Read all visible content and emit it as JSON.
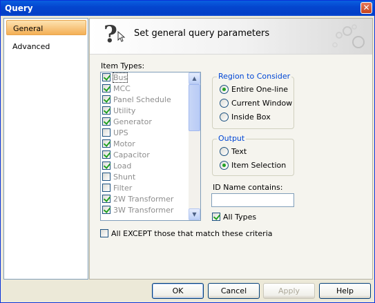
{
  "window": {
    "title": "Query",
    "close_glyph": "✕"
  },
  "nav": {
    "items": [
      {
        "label": "General",
        "active": true
      },
      {
        "label": "Advanced",
        "active": false
      }
    ]
  },
  "banner": {
    "title": "Set general query parameters",
    "icon": "help-question-icon"
  },
  "item_types": {
    "label": "Item Types:",
    "items": [
      {
        "label": "Bus",
        "checked": true
      },
      {
        "label": "MCC",
        "checked": true
      },
      {
        "label": "Panel Schedule",
        "checked": true
      },
      {
        "label": "Utility",
        "checked": true
      },
      {
        "label": "Generator",
        "checked": true
      },
      {
        "label": "UPS",
        "checked": false
      },
      {
        "label": "Motor",
        "checked": true
      },
      {
        "label": "Capacitor",
        "checked": true
      },
      {
        "label": "Load",
        "checked": true
      },
      {
        "label": "Shunt",
        "checked": false
      },
      {
        "label": "Filter",
        "checked": false
      },
      {
        "label": "2W Transformer",
        "checked": true
      },
      {
        "label": "3W Transformer",
        "checked": true
      }
    ],
    "scroll_up": "▲",
    "scroll_down": "▼"
  },
  "region": {
    "title": "Region to Consider",
    "options": [
      {
        "label": "Entire One-line",
        "selected": true
      },
      {
        "label": "Current Window",
        "selected": false
      },
      {
        "label": "Inside Box",
        "selected": false
      }
    ]
  },
  "output": {
    "title": "Output",
    "options": [
      {
        "label": "Text",
        "selected": false
      },
      {
        "label": "Item Selection",
        "selected": true
      }
    ]
  },
  "id_name": {
    "label": "ID Name contains:",
    "value": ""
  },
  "all_types": {
    "label": "All Types",
    "checked": true
  },
  "except": {
    "label": "All EXCEPT those that match these criteria",
    "checked": false
  },
  "buttons": {
    "ok": "OK",
    "cancel": "Cancel",
    "apply": "Apply",
    "help": "Help"
  },
  "colors": {
    "title_bar": "#0446cf",
    "group_title": "#0046d5",
    "selected_nav": "#f7c37a"
  }
}
